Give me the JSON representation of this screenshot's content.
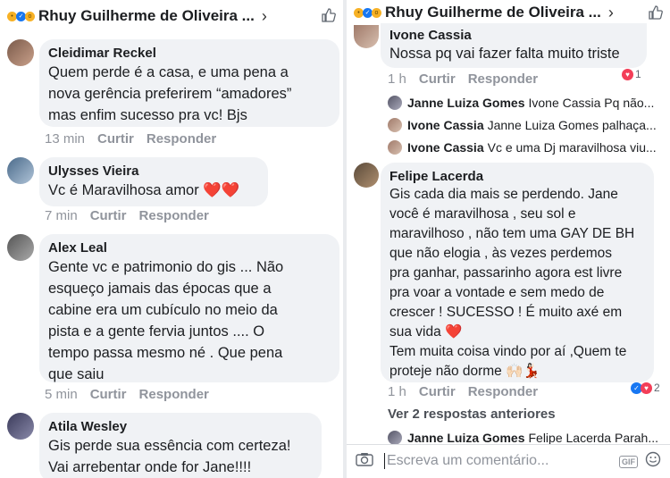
{
  "header": {
    "title": "Rhuy Guilherme de Oliveira ...",
    "chevron": "›"
  },
  "actions": {
    "like": "Curtir",
    "reply": "Responder"
  },
  "left_comments": [
    {
      "name": "Cleidimar Reckel",
      "lines": [
        "Quem perde é a casa, e uma pena a",
        "nova gerência preferirem “amadores”",
        "mas enfim sucesso pra vc! Bjs"
      ],
      "time": "13 min"
    },
    {
      "name": "Ulysses Vieira",
      "lines": [
        "Vc é Maravilhosa amor ❤️❤️"
      ],
      "time": "7 min"
    },
    {
      "name": "Alex Leal",
      "lines": [
        "Gente vc e patrimonio do gis ... Não",
        "esqueço jamais das épocas que a",
        "cabine era um cubículo no meio da",
        "pista e a gente fervia juntos .... O",
        "tempo passa mesmo né . Que pena",
        "que saiu"
      ],
      "time": "5 min"
    },
    {
      "name": "Atila Wesley",
      "lines": [
        "Gis perde sua essência com certeza!",
        "Vai arrebentar onde for Jane!!!!"
      ],
      "time": ""
    }
  ],
  "right_top_comment": {
    "name": "Ivone Cassia",
    "lines": [
      "Nossa pq vai fazer falta muito triste"
    ],
    "time": "1 h",
    "reaction_count": "1"
  },
  "right_replies": [
    {
      "name": "Janne Luiza Gomes",
      "text": "Ivone Cassia Pq não..."
    },
    {
      "name": "Ivone Cassia",
      "text": "Janne Luiza Gomes palhaça..."
    },
    {
      "name": "Ivone Cassia",
      "text": "Vc e uma Dj maravilhosa viu..."
    }
  ],
  "right_main_comment": {
    "name": "Felipe Lacerda",
    "lines": [
      "Gis cada dia mais se perdendo. Jane",
      "você é maravilhosa , seu sol e",
      "maravilhoso , não tem uma GAY DE BH",
      "que não elogia , às vezes perdemos",
      "pra ganhar, passarinho agora est livre",
      "pra voar a vontade e sem medo de",
      "crescer ! SUCESSO ! É muito axé em",
      "sua vida ❤️",
      "Tem muita coisa vindo por aí ,Quem te",
      "proteje não dorme 🙌🏻💃🏻"
    ],
    "time": "1 h",
    "reaction_count": "2"
  },
  "more_replies": "Ver 2 respostas anteriores",
  "last_reply": {
    "name": "Janne Luiza Gomes",
    "text": "Felipe Lacerda Parah..."
  },
  "composer": {
    "placeholder": "Escreva um comentário...",
    "gif_label": "GIF"
  },
  "icons": {
    "thumb": "thumbs-up-icon",
    "camera": "camera-icon",
    "smile": "smile-icon"
  },
  "colors": {
    "bubble": "#f0f2f5",
    "meta": "#90949c",
    "like_blue": "#1877f2",
    "heart_red": "#f33e58"
  }
}
